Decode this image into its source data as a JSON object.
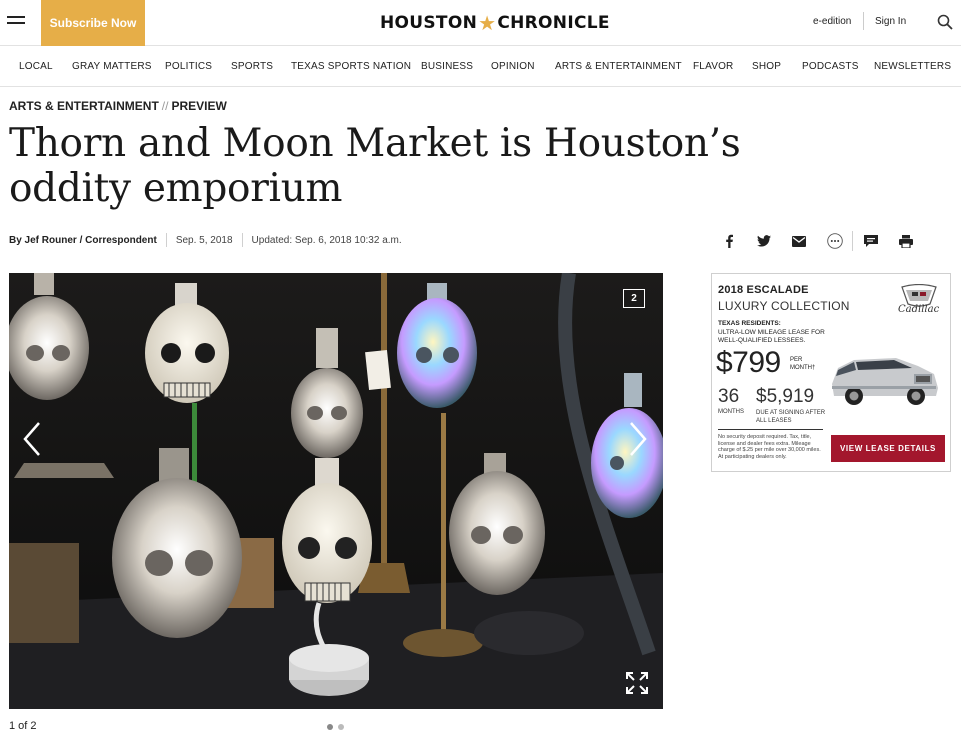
{
  "header": {
    "subscribe_label": "Subscribe Now",
    "logo_left": "HOUSTON",
    "logo_right": "CHRONICLE",
    "eedition_label": "e-edition",
    "signin_label": "Sign In",
    "brand_color": "#e6ae48"
  },
  "nav": {
    "items": [
      "LOCAL",
      "GRAY MATTERS",
      "POLITICS",
      "SPORTS",
      "TEXAS SPORTS NATION",
      "BUSINESS",
      "OPINION",
      "ARTS & ENTERTAINMENT",
      "FLAVOR",
      "SHOP",
      "PODCASTS",
      "NEWSLETTERS"
    ]
  },
  "article": {
    "section": "ARTS & ENTERTAINMENT",
    "section_sep": "//",
    "subsection": "PREVIEW",
    "headline": "Thorn and Moon Market is Houston’s oddity emporium",
    "author": "By Jef Rouner / Correspondent",
    "published": "Sep. 5, 2018",
    "updated": "Updated: Sep. 6, 2018 10:32 a.m."
  },
  "share_icons": [
    "facebook-icon",
    "twitter-icon",
    "email-icon",
    "more-icon",
    "comments-icon",
    "print-icon"
  ],
  "gallery": {
    "photo_count_badge": "2",
    "counter": "1 of 2",
    "slides": 2,
    "active_slide": 1
  },
  "ad": {
    "model": "2018 ESCALADE",
    "collection": "LUXURY COLLECTION",
    "brand": "Cadillac",
    "residents_title": "TEXAS RESIDENTS:",
    "residents_text": "ULTRA-LOW MILEAGE LEASE FOR WELL-QUALIFIED LESSEES.",
    "price": "$799",
    "per_month": "PER MONTH†",
    "months": "36",
    "months_label": "MONTHS",
    "due": "$5,919",
    "due_label": "DUE AT SIGNING AFTER ALL LEASES",
    "fine_print": "No security deposit required. Tax, title, license and dealer fees extra. Mileage charge of $.25 per mile over 30,000 miles. At participating dealers only.",
    "cta": "VIEW LEASE DETAILS",
    "cta_color": "#a3172d"
  }
}
